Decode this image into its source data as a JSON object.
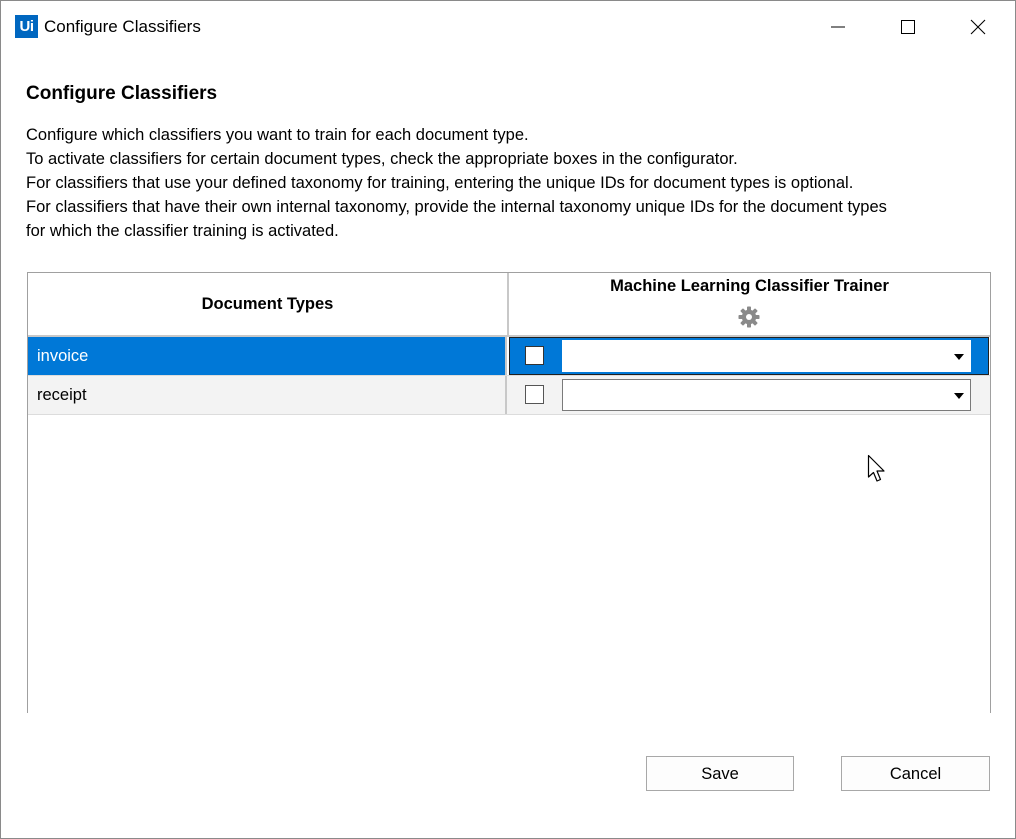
{
  "window": {
    "logo_text": "Ui",
    "title": "Configure Classifiers"
  },
  "heading": "Configure Classifiers",
  "description": [
    "Configure which classifiers you want to train for each document type.",
    "To activate classifiers for certain document types, check the appropriate boxes in the configurator.",
    "For classifiers that use your defined taxonomy for training, entering the unique IDs for document types is optional.",
    "For classifiers that have their own internal taxonomy, provide the internal taxonomy unique IDs for the document types",
    "for which the classifier training is activated."
  ],
  "grid": {
    "col_document_types": "Document Types",
    "col_classifier": "Machine Learning Classifier Trainer",
    "classifier_icon": "gear-icon",
    "rows": [
      {
        "document_type": "invoice",
        "checked": false,
        "id_value": "",
        "selected": true
      },
      {
        "document_type": "receipt",
        "checked": false,
        "id_value": "",
        "selected": false
      }
    ]
  },
  "buttons": {
    "save": "Save",
    "cancel": "Cancel"
  },
  "colors": {
    "selection": "#0078d7",
    "logo": "#0067c0"
  }
}
